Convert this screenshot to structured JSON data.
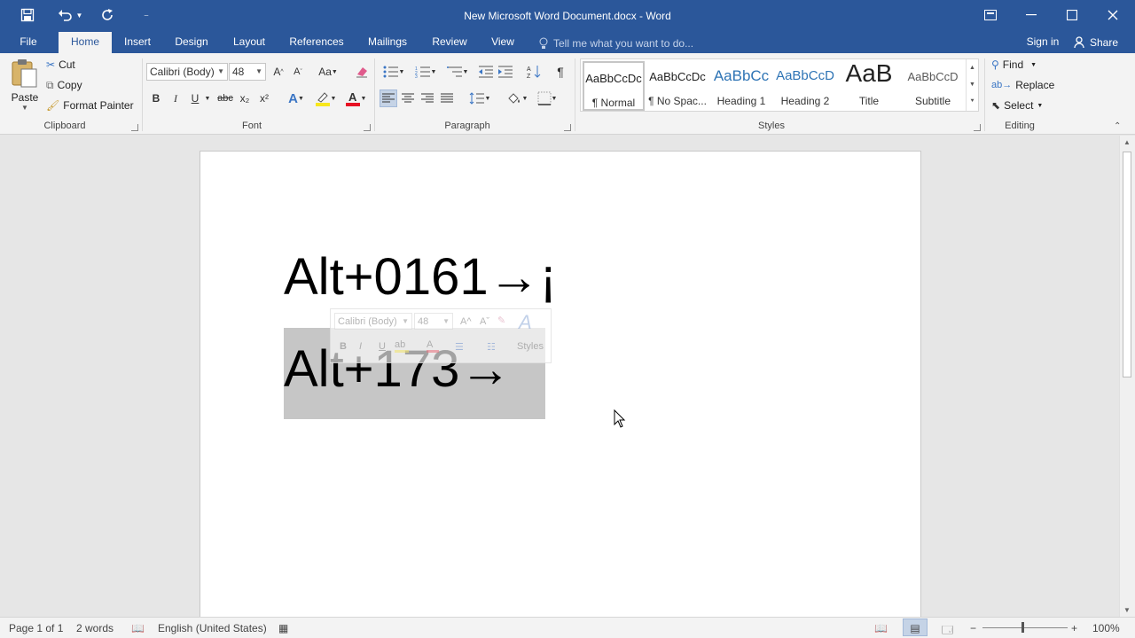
{
  "window": {
    "title": "New Microsoft Word Document.docx - Word"
  },
  "tabs": {
    "file": "File",
    "home": "Home",
    "insert": "Insert",
    "design": "Design",
    "layout": "Layout",
    "references": "References",
    "mailings": "Mailings",
    "review": "Review",
    "view": "View",
    "tell_me": "Tell me what you want to do...",
    "sign_in": "Sign in",
    "share": "Share"
  },
  "clipboard": {
    "paste": "Paste",
    "cut": "Cut",
    "copy": "Copy",
    "format_painter": "Format Painter",
    "label": "Clipboard"
  },
  "font": {
    "name": "Calibri (Body)",
    "size": "48",
    "label": "Font",
    "bold": "B",
    "italic": "I",
    "underline": "U",
    "strike": "abc",
    "sub": "x₂",
    "sup": "x²",
    "grow": "A^",
    "shrink": "Aˇ",
    "case": "Aa",
    "highlight_color": "#f8e71c",
    "font_color": "#e81123"
  },
  "paragraph": {
    "label": "Paragraph",
    "pilcrow": "¶"
  },
  "styles": {
    "label": "Styles",
    "items": [
      {
        "preview": "AaBbCcDc",
        "name": "¶ Normal"
      },
      {
        "preview": "AaBbCcDc",
        "name": "¶ No Spac..."
      },
      {
        "preview": "AaBbCc",
        "name": "Heading 1"
      },
      {
        "preview": "AaBbCcD",
        "name": "Heading 2"
      },
      {
        "preview": "AaB",
        "name": "Title"
      },
      {
        "preview": "AaBbCcD",
        "name": "Subtitle"
      }
    ],
    "heading_color": "#2e74b5"
  },
  "editing": {
    "label": "Editing",
    "find": "Find",
    "replace": "Replace",
    "select": "Select"
  },
  "document": {
    "line1": "Alt+0161→¡",
    "line2": "Alt+173→"
  },
  "mini_toolbar": {
    "font": "Calibri (Body)",
    "size": "48",
    "styles": "Styles"
  },
  "status": {
    "page": "Page 1 of 1",
    "words": "2 words",
    "language": "English (United States)",
    "zoom": "100%"
  }
}
